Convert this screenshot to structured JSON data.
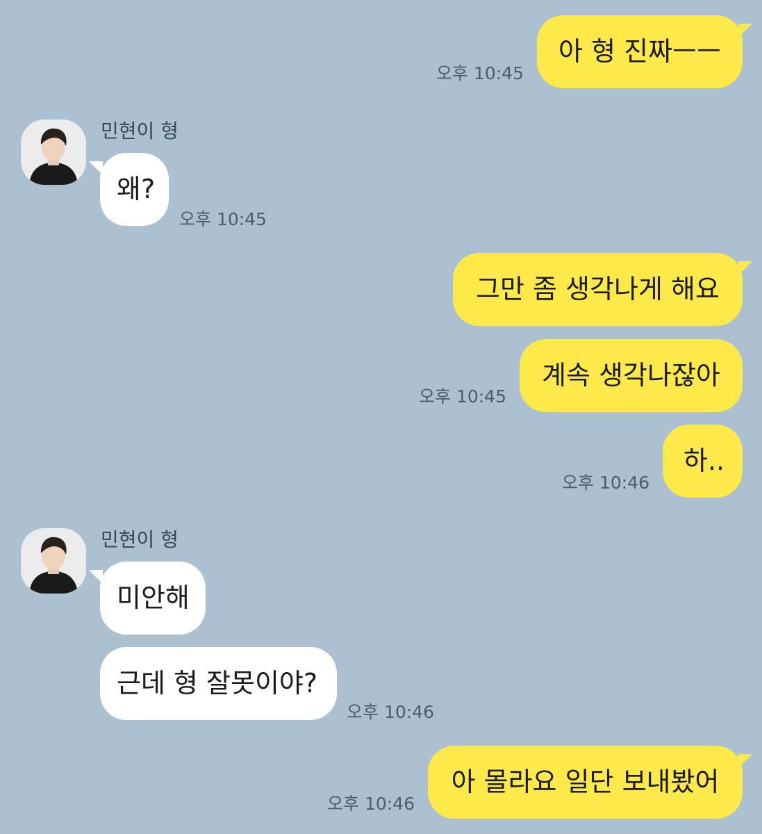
{
  "contact": {
    "name": "민현이 형"
  },
  "colors": {
    "background": "#abc1d1",
    "outgoing_bubble": "#fee94b",
    "incoming_bubble": "#ffffff"
  },
  "messages": [
    {
      "sender": "me",
      "text": "아 형 진짜ㅡㅡ",
      "time": "오후 10:45"
    },
    {
      "sender": "them",
      "text": "왜?",
      "time": "오후 10:45"
    },
    {
      "sender": "me",
      "text": "그만 좀 생각나게 해요",
      "time": ""
    },
    {
      "sender": "me",
      "text": "계속 생각나잖아",
      "time": "오후 10:45"
    },
    {
      "sender": "me",
      "text": "하..",
      "time": "오후 10:46"
    },
    {
      "sender": "them",
      "text": "미안해",
      "time": ""
    },
    {
      "sender": "them",
      "text": "근데 형 잘못이야?",
      "time": "오후 10:46"
    },
    {
      "sender": "me",
      "text": "아 몰라요 일단 보내봤어",
      "time": "오후 10:46"
    }
  ],
  "avatar_icon": "profile-photo-icon"
}
